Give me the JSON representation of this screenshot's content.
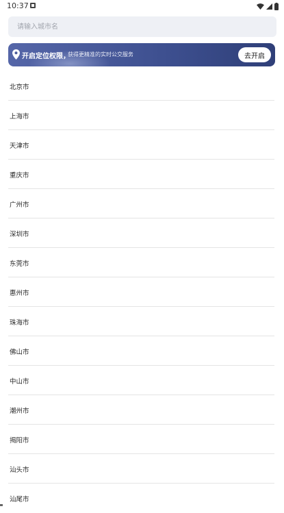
{
  "status_bar": {
    "time": "10:37"
  },
  "search": {
    "placeholder": "请输入城市名"
  },
  "location_banner": {
    "title": "开启定位权限，",
    "description": "获得更精准的实时公交服务",
    "button_label": "去开启",
    "bg_color": "#3d4f8f"
  },
  "cities": [
    {
      "name": "北京市"
    },
    {
      "name": "上海市"
    },
    {
      "name": "天津市"
    },
    {
      "name": "重庆市"
    },
    {
      "name": "广州市"
    },
    {
      "name": "深圳市"
    },
    {
      "name": "东莞市"
    },
    {
      "name": "惠州市"
    },
    {
      "name": "珠海市"
    },
    {
      "name": "佛山市"
    },
    {
      "name": "中山市"
    },
    {
      "name": "潮州市"
    },
    {
      "name": "揭阳市"
    },
    {
      "name": "汕头市"
    },
    {
      "name": "汕尾市"
    }
  ]
}
